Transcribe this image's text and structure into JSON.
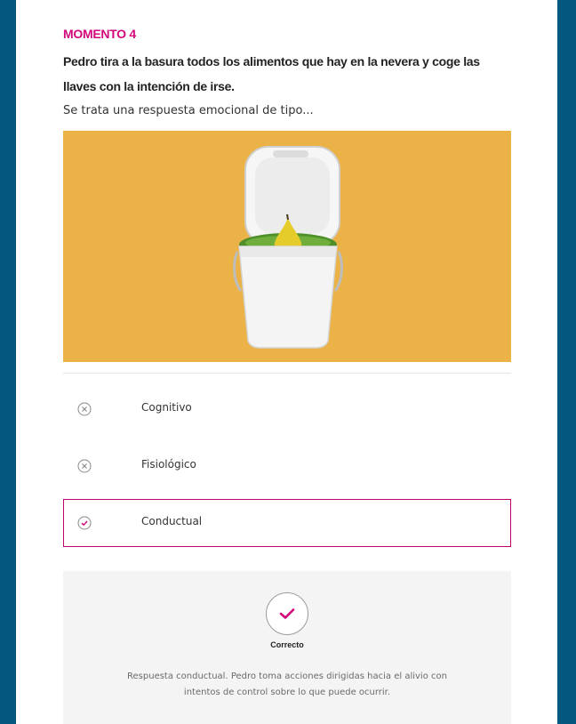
{
  "moment": {
    "label": "MOMENTO 4",
    "question": "Pedro tira a la basura todos los alimentos que hay en la nevera y coge las llaves con la intención de irse.",
    "prompt": "Se trata una respuesta emocional de tipo..."
  },
  "image": {
    "subject": "compost-bin-with-pear",
    "background": "#ebb247"
  },
  "options": [
    {
      "label": "Cognitivo",
      "state": "incorrect",
      "icon": "x-circle-icon"
    },
    {
      "label": "Fisiológico",
      "state": "incorrect",
      "icon": "x-circle-icon"
    },
    {
      "label": "Conductual",
      "state": "selected",
      "icon": "check-circle-icon"
    }
  ],
  "feedback": {
    "status": "Correcto",
    "text": "Respuesta conductual. Pedro toma acciones dirigidas hacia el alivio con intentos de control sobre lo que puede ocurrir."
  },
  "colors": {
    "accent": "#d2077c",
    "frame": "#04577f"
  }
}
